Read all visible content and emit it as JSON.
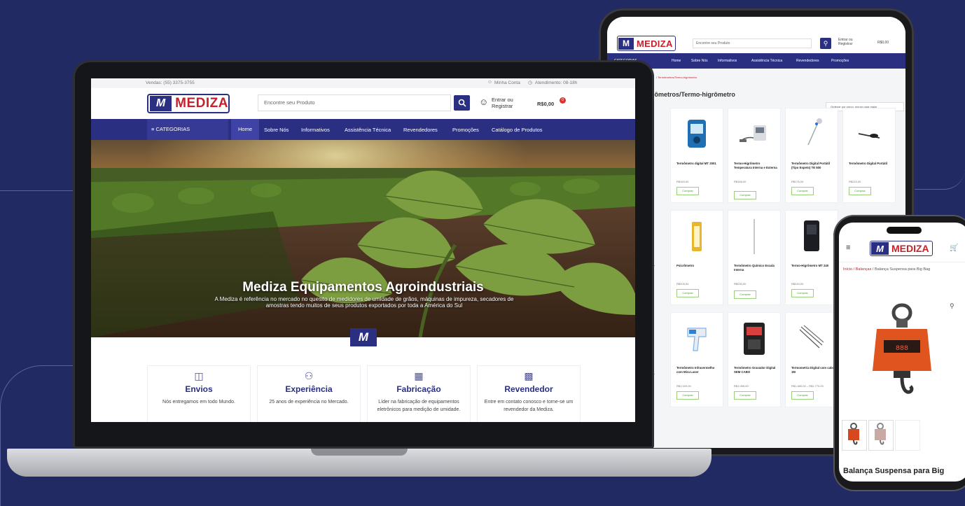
{
  "brand": {
    "logo_mark": "M",
    "logo_word": "MEDIZA"
  },
  "laptop": {
    "top_phone": "Vendas: (55) 3375-3755",
    "top_account": "Minha Conta",
    "top_hours": "Atendimento: 08-18h",
    "search_placeholder": "Encontre seu Produto",
    "login_line1": "Entrar ou",
    "login_line2": "Registrar",
    "cart_total": "R$0,00",
    "cart_count": "0",
    "categories_label": "CATEGORIAS",
    "nav": [
      "Home",
      "Sobre Nós",
      "Informativos",
      "Assistência Técnica",
      "Revendedores",
      "Promoções",
      "Catálogo de Produtos"
    ],
    "hero_title": "Mediza Equipamentos Agroindustriais",
    "hero_text": "A Mediza é referência no mercado no quesito de medidores de umidade de grãos, máquinas de impureza, secadores de amostras tendo muitos de seus produtos exportados por toda a América do Sul",
    "features": [
      {
        "icon": "delivery-icon",
        "title": "Envios",
        "text": "Nós entregamos em todo Mundo."
      },
      {
        "icon": "trophy-icon",
        "title": "Experiência",
        "text": "25 anos de experiência no Mercado."
      },
      {
        "icon": "circuit-icon",
        "title": "Fabricação",
        "text": "Líder na fabricação de equipamentos eletrônicos para medição de umidade."
      },
      {
        "icon": "reseller-icon",
        "title": "Revendedor",
        "text": "Entre em contato conosco e torne-se um revendedor da Mediza."
      }
    ]
  },
  "tablet": {
    "search_placeholder": "Encontre seu Produto",
    "login_line1": "Entrar ou",
    "login_line2": "Registrar",
    "cart_total": "R$0,00",
    "categories_label": "CATEGORIAS",
    "nav": [
      "Home",
      "Sobre Nós",
      "Informativos",
      "Assistência Técnica",
      "Revendedores",
      "Promoções"
    ],
    "breadcrumb": "/ Termômetros/Termo-higrômetro",
    "page_title": "rmômetros/Termo-higrômetro",
    "result_count": "do",
    "sort_label": "Ordenar por preço: menor para maior",
    "buy_label": "Comprar",
    "products": [
      {
        "name": "Termômetro digital MT 2001",
        "price": "R$160,00"
      },
      {
        "name": "Termo-Higrômetro Temperatura Interna e Externa",
        "price": "R$168,00"
      },
      {
        "name": "Termômetro Digital Portátil (Tipo Espeto) TE 500",
        "price": "R$176,00"
      },
      {
        "name": "Termômetro Digital Portátil",
        "price": "R$210,00"
      },
      {
        "name": "Psicrômetro",
        "price": "R$205,00"
      },
      {
        "name": "Termômetro Químico Escala Interna",
        "price": "R$230,00"
      },
      {
        "name": "Termo-Higrômetro MT 240",
        "price": "R$240,00"
      },
      {
        "name": "Termômetro Infravermelho com Mira Laser",
        "price": "R$1.020,00"
      },
      {
        "name": "Termômetro Gravador Digital SEM CABO",
        "price": "R$1.056,00"
      },
      {
        "name": "Termometria Digital com cabos 1M",
        "price": "R$1.480,00 – R$1.770,00"
      }
    ],
    "side_labels": [
      "l",
      "NT",
      "ALO"
    ]
  },
  "phone": {
    "breadcrumb_red": "Início / Balanças",
    "breadcrumb_rest": " / Balança Suspensa para Big Bag",
    "product_title": "Balança Suspensa para Big"
  },
  "colors": {
    "navy": "#2b2f82",
    "red": "#c7202b",
    "background": "#222a63"
  }
}
